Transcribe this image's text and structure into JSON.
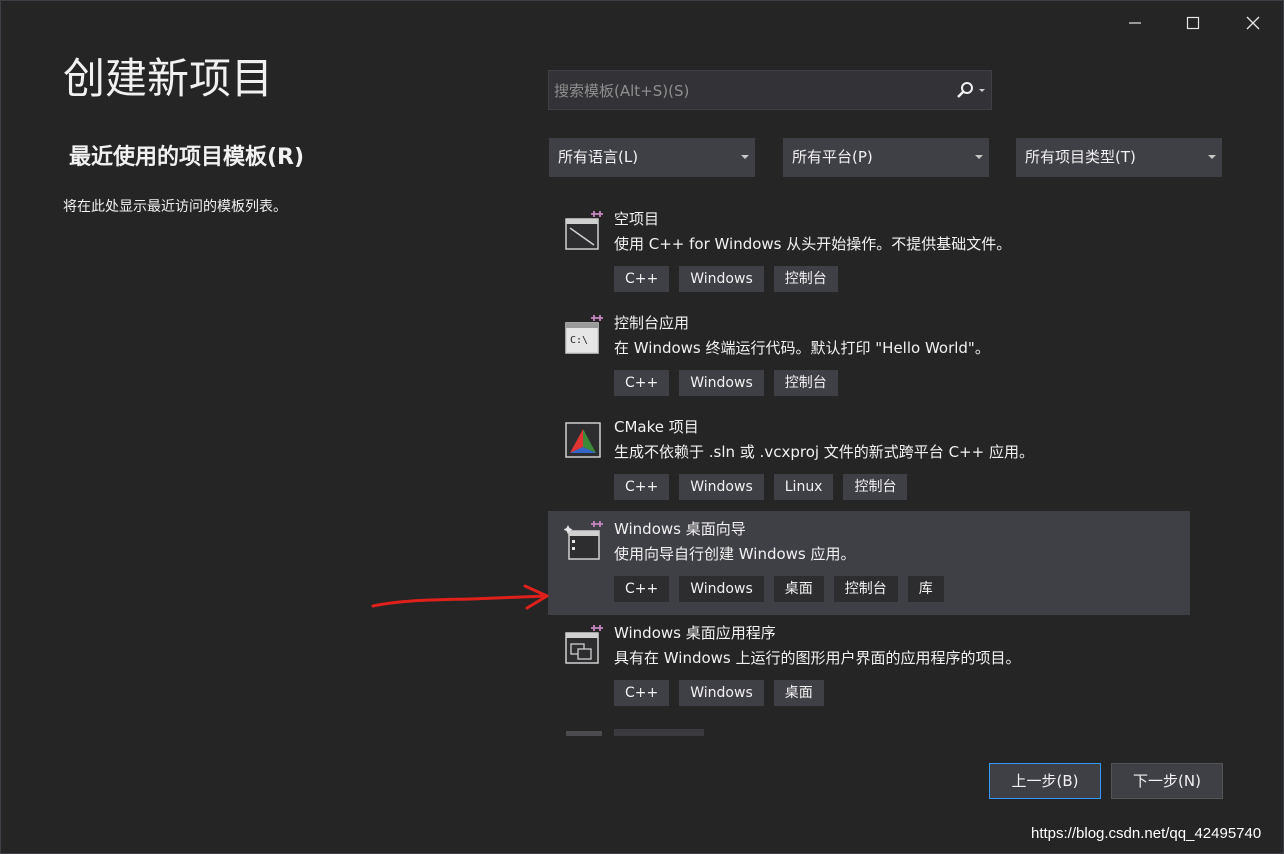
{
  "window": {
    "title": "创建新项目",
    "controls": {
      "minimize": "minimize-icon",
      "maximize": "maximize-icon",
      "close": "close-icon"
    }
  },
  "recent": {
    "heading": "最近使用的项目模板(R)",
    "empty_text": "将在此处显示最近访问的模板列表。"
  },
  "search": {
    "placeholder": "搜索模板(Alt+S)(S)",
    "icon": "search-icon"
  },
  "filters": [
    {
      "label": "所有语言(L)"
    },
    {
      "label": "所有平台(P)"
    },
    {
      "label": "所有项目类型(T)"
    }
  ],
  "templates": [
    {
      "name": "空项目",
      "description": "使用 C++ for Windows 从头开始操作。不提供基础文件。",
      "tags": [
        "C++",
        "Windows",
        "控制台"
      ],
      "icon": "empty-project-icon",
      "selected": false
    },
    {
      "name": "控制台应用",
      "description": "在 Windows 终端运行代码。默认打印 \"Hello World\"。",
      "tags": [
        "C++",
        "Windows",
        "控制台"
      ],
      "icon": "console-app-icon",
      "selected": false
    },
    {
      "name": "CMake 项目",
      "description": "生成不依赖于 .sln 或 .vcxproj 文件的新式跨平台 C++ 应用。",
      "tags": [
        "C++",
        "Windows",
        "Linux",
        "控制台"
      ],
      "icon": "cmake-icon",
      "selected": false
    },
    {
      "name": "Windows 桌面向导",
      "description": "使用向导自行创建 Windows 应用。",
      "tags": [
        "C++",
        "Windows",
        "桌面",
        "控制台",
        "库"
      ],
      "icon": "desktop-wizard-icon",
      "selected": true
    },
    {
      "name": "Windows 桌面应用程序",
      "description": "具有在 Windows 上运行的图形用户界面的应用程序的项目。",
      "tags": [
        "C++",
        "Windows",
        "桌面"
      ],
      "icon": "desktop-app-icon",
      "selected": false
    }
  ],
  "buttons": {
    "back": "上一步(B)",
    "next": "下一步(N)"
  },
  "colors": {
    "background": "#252526",
    "surface": "#3f3f46",
    "accent": "#3399ff",
    "annotation": "#e0201b"
  },
  "watermark": "https://blog.csdn.net/qq_42495740"
}
